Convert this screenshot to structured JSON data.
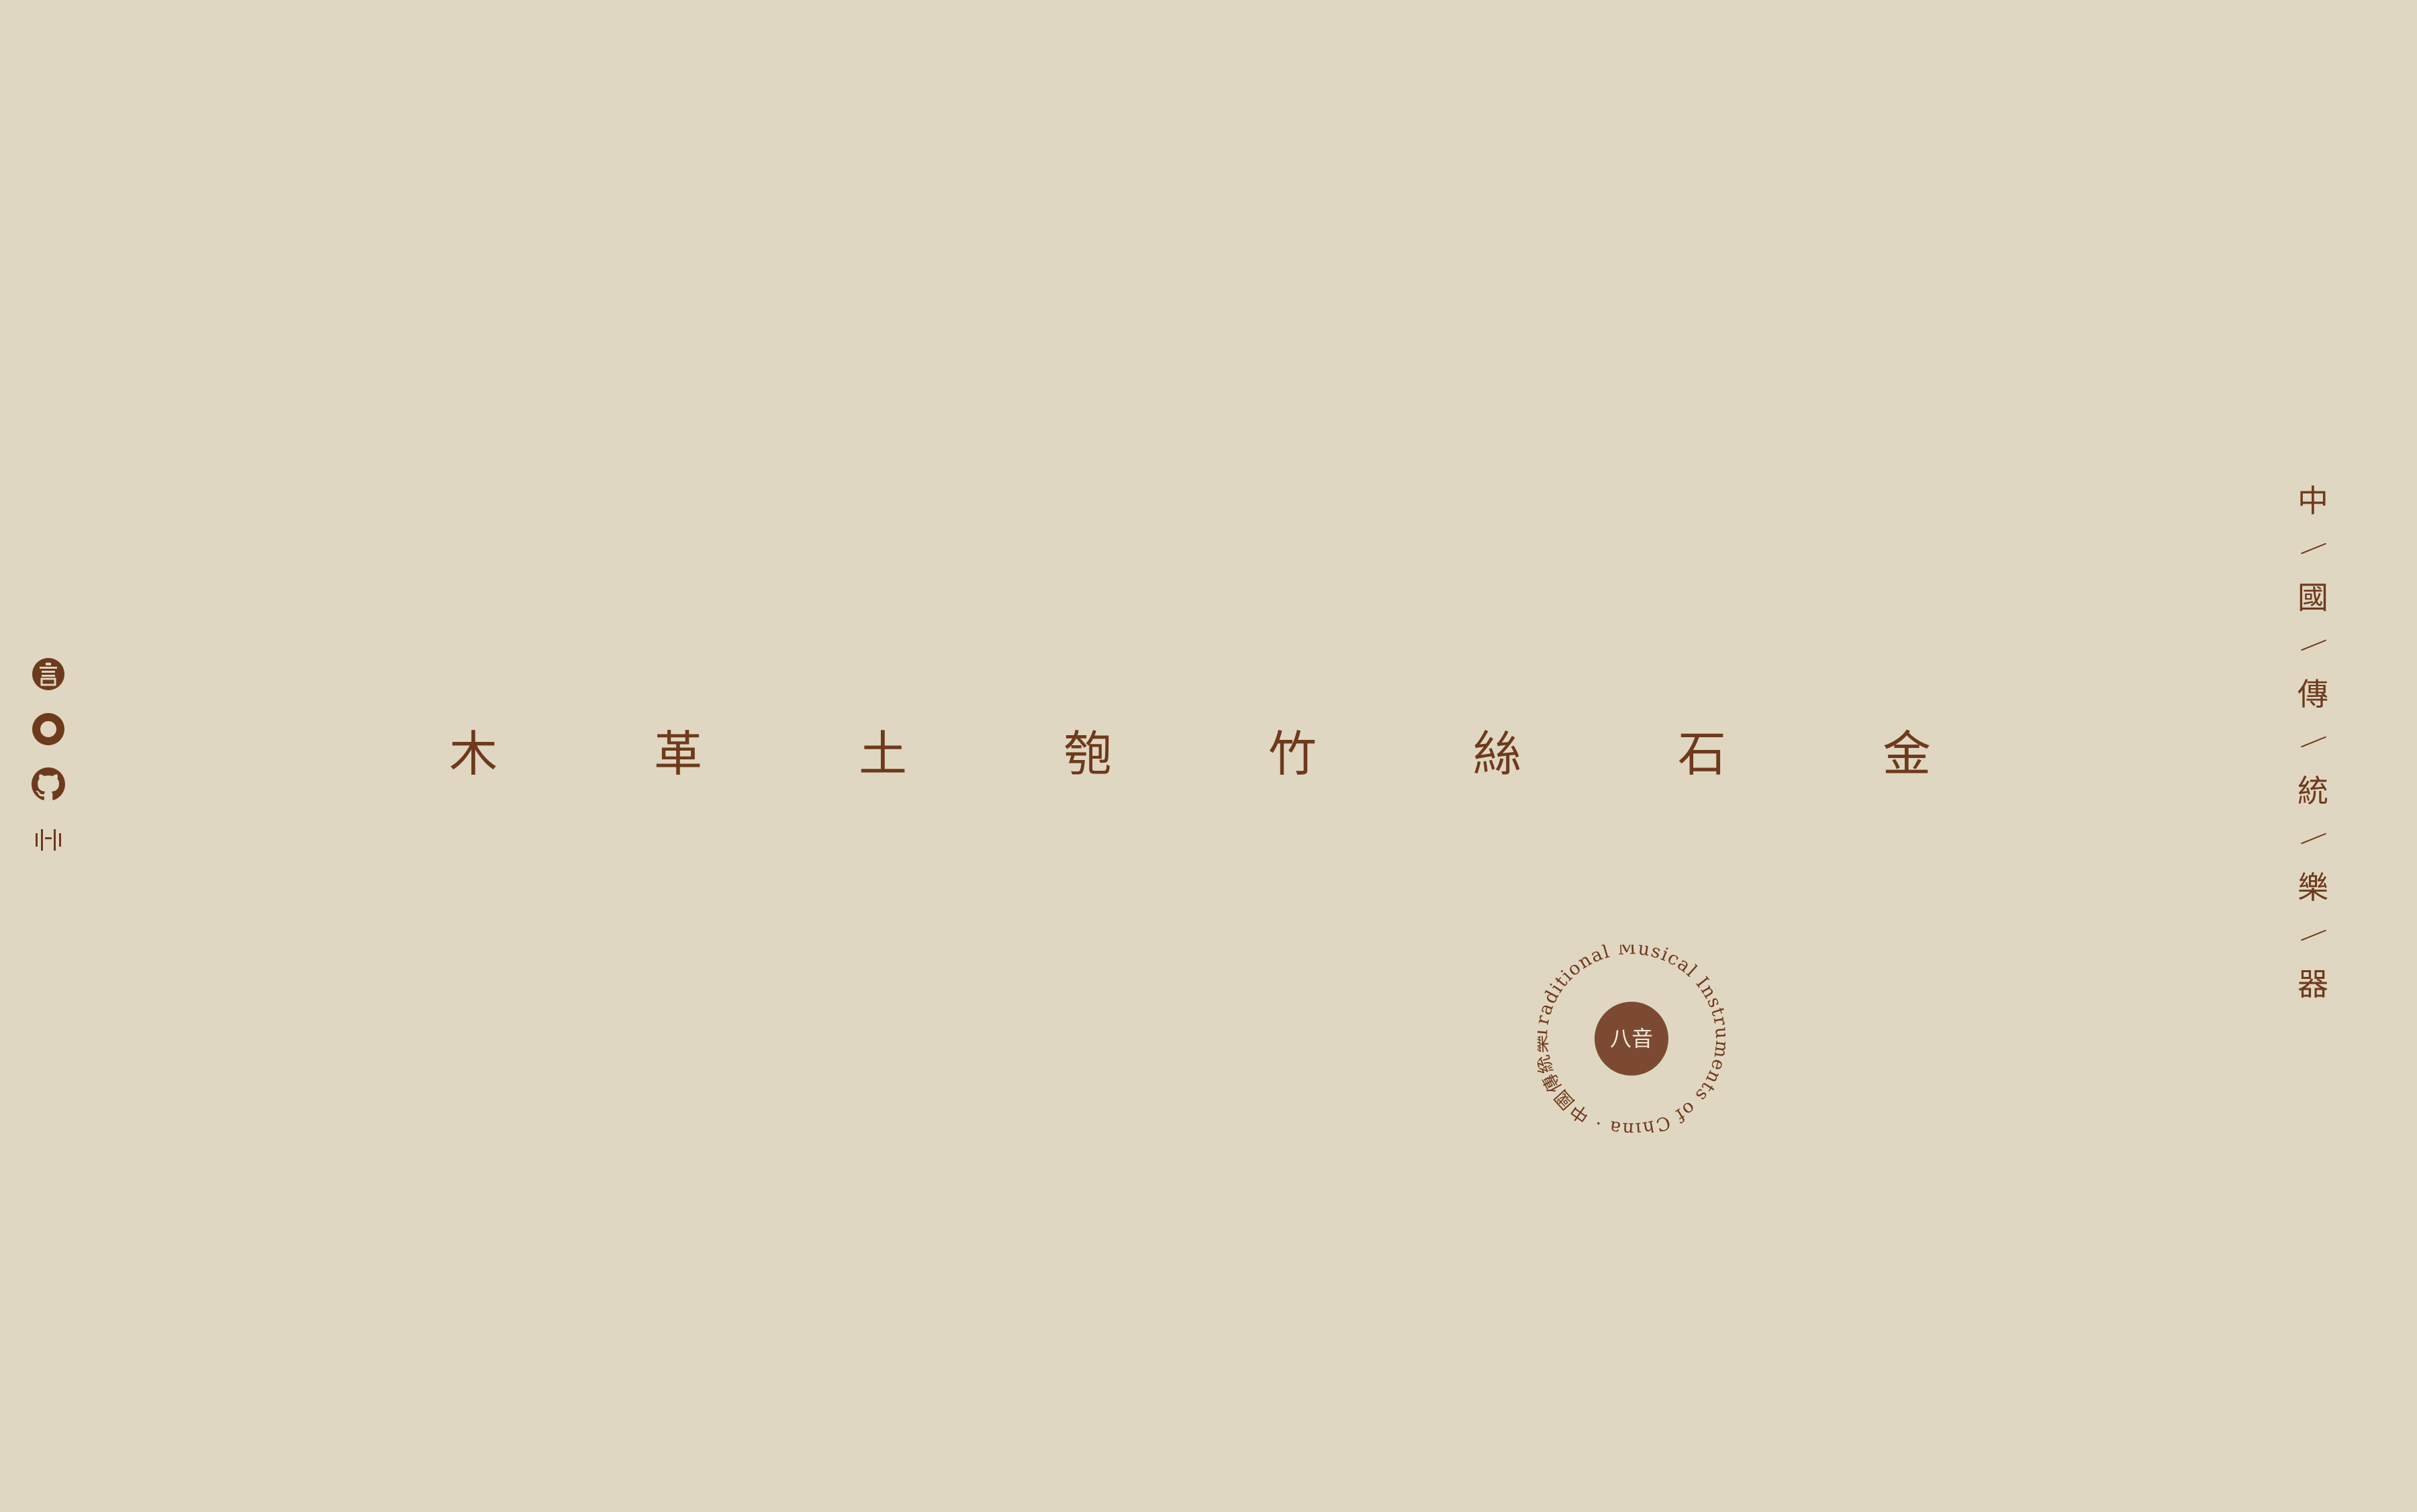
{
  "side_links": [
    {
      "name": "yan-icon",
      "label": "言"
    },
    {
      "name": "ring-icon",
      "label": ""
    },
    {
      "name": "github-icon",
      "label": ""
    },
    {
      "name": "bars-icon",
      "label": ""
    }
  ],
  "categories": [
    "木",
    "革",
    "土",
    "匏",
    "竹",
    "絲",
    "石",
    "金"
  ],
  "vertical_title": [
    "中",
    "國",
    "傳",
    "統",
    "樂",
    "器"
  ],
  "badge": {
    "center": "八音",
    "ring_text": "Traditional Musical Instruments of China · 中國傳統樂器 ·"
  },
  "colors": {
    "background": "#e0d7c2",
    "accent": "#6e3a1c",
    "badge_fill": "#7c4a32"
  }
}
